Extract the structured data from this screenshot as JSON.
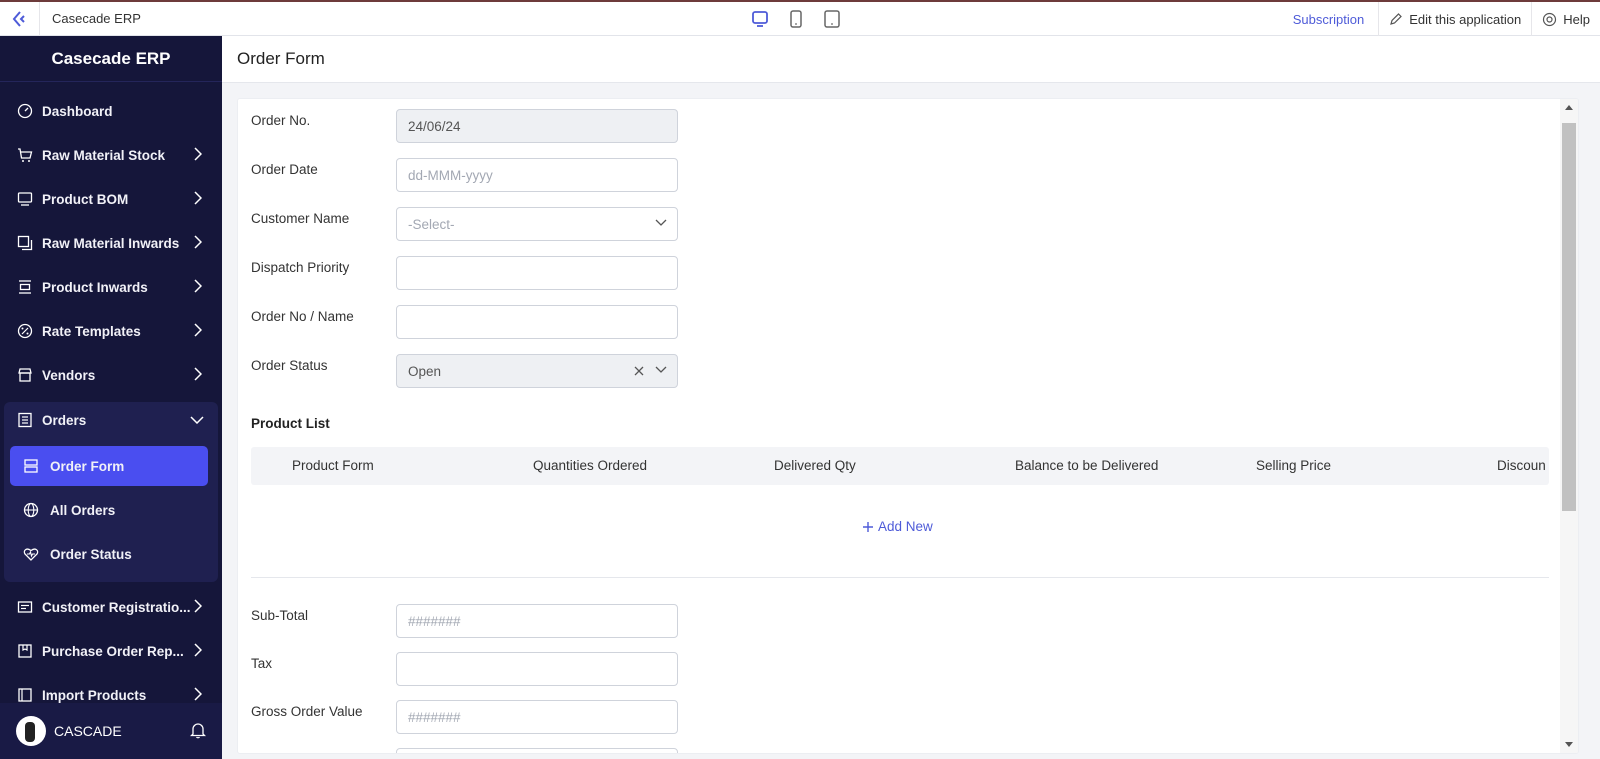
{
  "topbar": {
    "app_title": "Casecade ERP",
    "subscription": "Subscription",
    "edit": "Edit this application",
    "help": "Help"
  },
  "sidebar": {
    "brand": "Casecade ERP",
    "items": [
      {
        "label": "Dashboard",
        "icon": "dashboard-icon"
      },
      {
        "label": "Raw Material Stock",
        "icon": "cart-icon"
      },
      {
        "label": "Product BOM",
        "icon": "monitor-icon"
      },
      {
        "label": "Raw Material Inwards",
        "icon": "copy-icon"
      },
      {
        "label": "Product Inwards",
        "icon": "inbox-icon"
      },
      {
        "label": "Rate Templates",
        "icon": "percent-icon"
      },
      {
        "label": "Vendors",
        "icon": "store-icon"
      },
      {
        "label": "Orders",
        "icon": "list-icon"
      }
    ],
    "sub_items": [
      {
        "label": "Order Form",
        "icon": "form-icon"
      },
      {
        "label": "All Orders",
        "icon": "globe-icon"
      },
      {
        "label": "Order Status",
        "icon": "heart-pulse-icon"
      }
    ],
    "items_after": [
      {
        "label": "Customer Registratio...",
        "icon": "id-card-icon"
      },
      {
        "label": "Purchase Order Rep...",
        "icon": "package-icon"
      },
      {
        "label": "Import Products",
        "icon": "import-icon"
      }
    ],
    "footer_name": "CASCADE"
  },
  "page": {
    "title": "Order Form"
  },
  "form": {
    "order_no_label": "Order No.",
    "order_no_value": "24/06/24",
    "order_date_label": "Order Date",
    "order_date_placeholder": "dd-MMM-yyyy",
    "customer_label": "Customer Name",
    "customer_placeholder": "-Select-",
    "dispatch_label": "Dispatch Priority",
    "order_name_label": "Order No / Name",
    "status_label": "Order Status",
    "status_value": "Open",
    "product_list_title": "Product List",
    "columns": [
      "Product Form",
      "Quantities Ordered",
      "Delivered Qty",
      "Balance to be Delivered",
      "Selling Price",
      "Discoun"
    ],
    "add_new": "Add New",
    "subtotal_label": "Sub-Total",
    "subtotal_placeholder": "#######",
    "tax_label": "Tax",
    "gross_label": "Gross Order Value",
    "gross_placeholder": "#######"
  },
  "colors": {
    "sidebar_bg": "#15163a",
    "accent": "#4a4ef0",
    "link": "#4e5bd8"
  }
}
